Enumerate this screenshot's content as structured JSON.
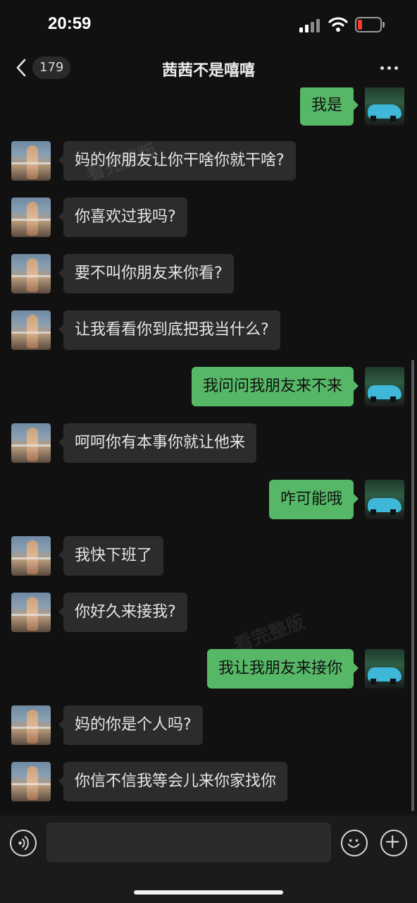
{
  "status_bar": {
    "time": "20:59",
    "battery_level": 0.1
  },
  "header": {
    "unread_count": "179",
    "title": "茜茜不是嘻嘻"
  },
  "watermarks": [
    "看完整版",
    "看完整版"
  ],
  "messages": [
    {
      "from": "me",
      "text": "我是"
    },
    {
      "from": "her",
      "text": "妈的你朋友让你干啥你就干啥?"
    },
    {
      "from": "her",
      "text": "你喜欢过我吗?"
    },
    {
      "from": "her",
      "text": "要不叫你朋友来你看?"
    },
    {
      "from": "her",
      "text": "让我看看你到底把我当什么?"
    },
    {
      "from": "me",
      "text": "我问问我朋友来不来"
    },
    {
      "from": "her",
      "text": "呵呵你有本事你就让他来"
    },
    {
      "from": "me",
      "text": "咋可能哦"
    },
    {
      "from": "her",
      "text": "我快下班了"
    },
    {
      "from": "her",
      "text": "你好久来接我?"
    },
    {
      "from": "me",
      "text": "我让我朋友来接你"
    },
    {
      "from": "her",
      "text": "妈的你是个人吗?"
    },
    {
      "from": "her",
      "text": "你信不信我等会儿来你家找你"
    }
  ],
  "input": {
    "value": "",
    "placeholder": ""
  },
  "icons": {
    "back": "chevron-left-icon",
    "more": "more-dots-icon",
    "voice": "voice-icon",
    "emoji": "emoji-icon",
    "plus": "plus-icon"
  },
  "colors": {
    "background": "#111111",
    "incoming_bubble": "#2c2c2c",
    "outgoing_bubble": "#56b866",
    "battery_low": "#ff3b30"
  }
}
